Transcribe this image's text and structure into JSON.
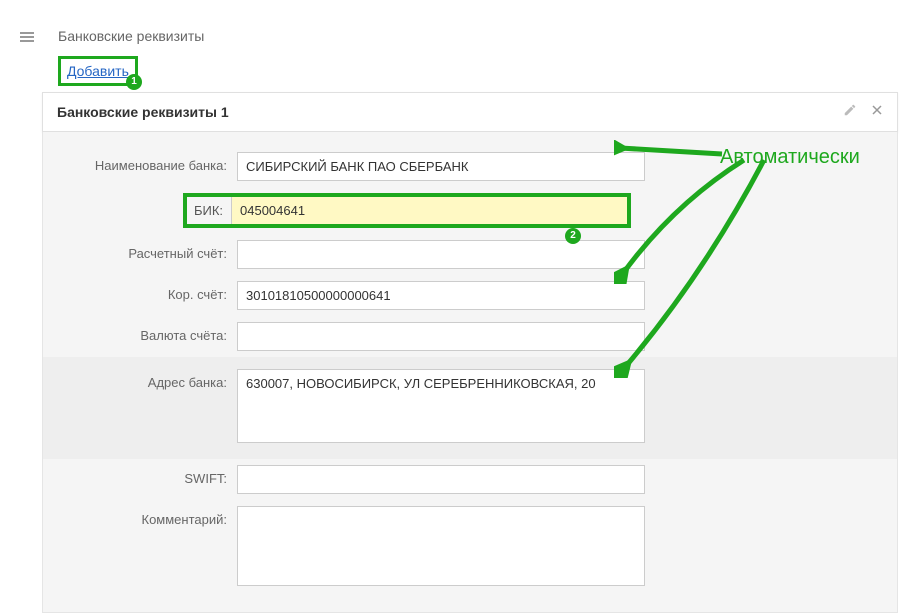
{
  "section": {
    "title": "Банковские реквизиты"
  },
  "actions": {
    "add": "Добавить"
  },
  "panel": {
    "title": "Банковские реквизиты 1"
  },
  "labels": {
    "bank_name": "Наименование банка:",
    "bik": "БИК:",
    "settlement_account": "Расчетный счёт:",
    "corr_account": "Кор. счёт:",
    "currency": "Валюта счёта:",
    "bank_address": "Адрес банка:",
    "swift": "SWIFT:",
    "comment": "Комментарий:"
  },
  "values": {
    "bank_name": "СИБИРСКИЙ БАНК ПАО СБЕРБАНК",
    "bik": "045004641",
    "settlement_account": "",
    "corr_account": "30101810500000000641",
    "currency": "",
    "bank_address": "630007, НОВОСИБИРСК, УЛ СЕРЕБРЕННИКОВСКАЯ, 20",
    "swift": "",
    "comment": ""
  },
  "annotations": {
    "auto": "Автоматически",
    "step1": "1",
    "step2": "2"
  }
}
